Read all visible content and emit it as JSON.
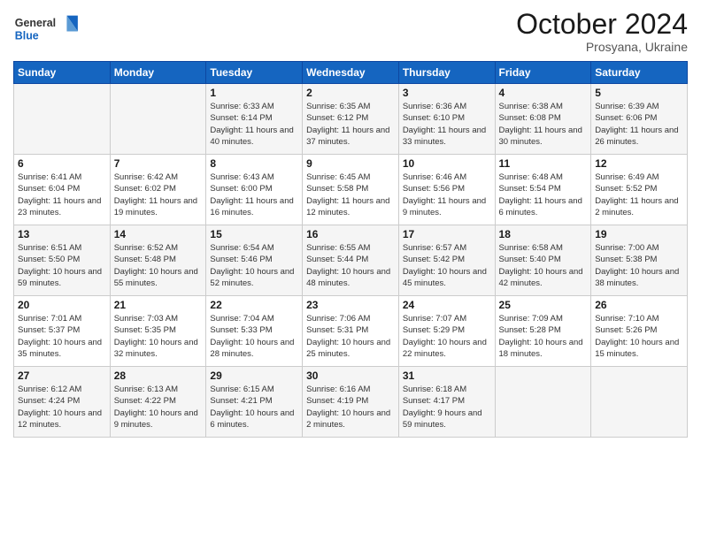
{
  "header": {
    "logo": {
      "general": "General",
      "blue": "Blue"
    },
    "title": "October 2024",
    "subtitle": "Prosyana, Ukraine"
  },
  "calendar": {
    "days_of_week": [
      "Sunday",
      "Monday",
      "Tuesday",
      "Wednesday",
      "Thursday",
      "Friday",
      "Saturday"
    ],
    "weeks": [
      [
        {
          "day": "",
          "sunrise": "",
          "sunset": "",
          "daylight": ""
        },
        {
          "day": "",
          "sunrise": "",
          "sunset": "",
          "daylight": ""
        },
        {
          "day": "1",
          "sunrise": "Sunrise: 6:33 AM",
          "sunset": "Sunset: 6:14 PM",
          "daylight": "Daylight: 11 hours and 40 minutes."
        },
        {
          "day": "2",
          "sunrise": "Sunrise: 6:35 AM",
          "sunset": "Sunset: 6:12 PM",
          "daylight": "Daylight: 11 hours and 37 minutes."
        },
        {
          "day": "3",
          "sunrise": "Sunrise: 6:36 AM",
          "sunset": "Sunset: 6:10 PM",
          "daylight": "Daylight: 11 hours and 33 minutes."
        },
        {
          "day": "4",
          "sunrise": "Sunrise: 6:38 AM",
          "sunset": "Sunset: 6:08 PM",
          "daylight": "Daylight: 11 hours and 30 minutes."
        },
        {
          "day": "5",
          "sunrise": "Sunrise: 6:39 AM",
          "sunset": "Sunset: 6:06 PM",
          "daylight": "Daylight: 11 hours and 26 minutes."
        }
      ],
      [
        {
          "day": "6",
          "sunrise": "Sunrise: 6:41 AM",
          "sunset": "Sunset: 6:04 PM",
          "daylight": "Daylight: 11 hours and 23 minutes."
        },
        {
          "day": "7",
          "sunrise": "Sunrise: 6:42 AM",
          "sunset": "Sunset: 6:02 PM",
          "daylight": "Daylight: 11 hours and 19 minutes."
        },
        {
          "day": "8",
          "sunrise": "Sunrise: 6:43 AM",
          "sunset": "Sunset: 6:00 PM",
          "daylight": "Daylight: 11 hours and 16 minutes."
        },
        {
          "day": "9",
          "sunrise": "Sunrise: 6:45 AM",
          "sunset": "Sunset: 5:58 PM",
          "daylight": "Daylight: 11 hours and 12 minutes."
        },
        {
          "day": "10",
          "sunrise": "Sunrise: 6:46 AM",
          "sunset": "Sunset: 5:56 PM",
          "daylight": "Daylight: 11 hours and 9 minutes."
        },
        {
          "day": "11",
          "sunrise": "Sunrise: 6:48 AM",
          "sunset": "Sunset: 5:54 PM",
          "daylight": "Daylight: 11 hours and 6 minutes."
        },
        {
          "day": "12",
          "sunrise": "Sunrise: 6:49 AM",
          "sunset": "Sunset: 5:52 PM",
          "daylight": "Daylight: 11 hours and 2 minutes."
        }
      ],
      [
        {
          "day": "13",
          "sunrise": "Sunrise: 6:51 AM",
          "sunset": "Sunset: 5:50 PM",
          "daylight": "Daylight: 10 hours and 59 minutes."
        },
        {
          "day": "14",
          "sunrise": "Sunrise: 6:52 AM",
          "sunset": "Sunset: 5:48 PM",
          "daylight": "Daylight: 10 hours and 55 minutes."
        },
        {
          "day": "15",
          "sunrise": "Sunrise: 6:54 AM",
          "sunset": "Sunset: 5:46 PM",
          "daylight": "Daylight: 10 hours and 52 minutes."
        },
        {
          "day": "16",
          "sunrise": "Sunrise: 6:55 AM",
          "sunset": "Sunset: 5:44 PM",
          "daylight": "Daylight: 10 hours and 48 minutes."
        },
        {
          "day": "17",
          "sunrise": "Sunrise: 6:57 AM",
          "sunset": "Sunset: 5:42 PM",
          "daylight": "Daylight: 10 hours and 45 minutes."
        },
        {
          "day": "18",
          "sunrise": "Sunrise: 6:58 AM",
          "sunset": "Sunset: 5:40 PM",
          "daylight": "Daylight: 10 hours and 42 minutes."
        },
        {
          "day": "19",
          "sunrise": "Sunrise: 7:00 AM",
          "sunset": "Sunset: 5:38 PM",
          "daylight": "Daylight: 10 hours and 38 minutes."
        }
      ],
      [
        {
          "day": "20",
          "sunrise": "Sunrise: 7:01 AM",
          "sunset": "Sunset: 5:37 PM",
          "daylight": "Daylight: 10 hours and 35 minutes."
        },
        {
          "day": "21",
          "sunrise": "Sunrise: 7:03 AM",
          "sunset": "Sunset: 5:35 PM",
          "daylight": "Daylight: 10 hours and 32 minutes."
        },
        {
          "day": "22",
          "sunrise": "Sunrise: 7:04 AM",
          "sunset": "Sunset: 5:33 PM",
          "daylight": "Daylight: 10 hours and 28 minutes."
        },
        {
          "day": "23",
          "sunrise": "Sunrise: 7:06 AM",
          "sunset": "Sunset: 5:31 PM",
          "daylight": "Daylight: 10 hours and 25 minutes."
        },
        {
          "day": "24",
          "sunrise": "Sunrise: 7:07 AM",
          "sunset": "Sunset: 5:29 PM",
          "daylight": "Daylight: 10 hours and 22 minutes."
        },
        {
          "day": "25",
          "sunrise": "Sunrise: 7:09 AM",
          "sunset": "Sunset: 5:28 PM",
          "daylight": "Daylight: 10 hours and 18 minutes."
        },
        {
          "day": "26",
          "sunrise": "Sunrise: 7:10 AM",
          "sunset": "Sunset: 5:26 PM",
          "daylight": "Daylight: 10 hours and 15 minutes."
        }
      ],
      [
        {
          "day": "27",
          "sunrise": "Sunrise: 6:12 AM",
          "sunset": "Sunset: 4:24 PM",
          "daylight": "Daylight: 10 hours and 12 minutes."
        },
        {
          "day": "28",
          "sunrise": "Sunrise: 6:13 AM",
          "sunset": "Sunset: 4:22 PM",
          "daylight": "Daylight: 10 hours and 9 minutes."
        },
        {
          "day": "29",
          "sunrise": "Sunrise: 6:15 AM",
          "sunset": "Sunset: 4:21 PM",
          "daylight": "Daylight: 10 hours and 6 minutes."
        },
        {
          "day": "30",
          "sunrise": "Sunrise: 6:16 AM",
          "sunset": "Sunset: 4:19 PM",
          "daylight": "Daylight: 10 hours and 2 minutes."
        },
        {
          "day": "31",
          "sunrise": "Sunrise: 6:18 AM",
          "sunset": "Sunset: 4:17 PM",
          "daylight": "Daylight: 9 hours and 59 minutes."
        },
        {
          "day": "",
          "sunrise": "",
          "sunset": "",
          "daylight": ""
        },
        {
          "day": "",
          "sunrise": "",
          "sunset": "",
          "daylight": ""
        }
      ]
    ]
  }
}
